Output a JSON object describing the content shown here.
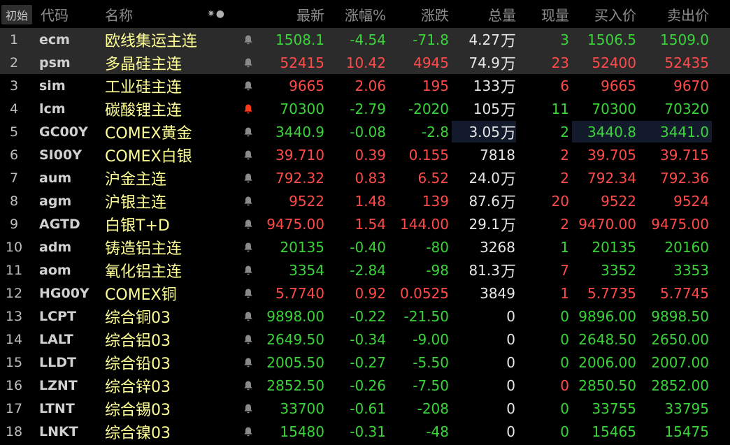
{
  "header": {
    "reset": "初始",
    "code": "代码",
    "name": "名称",
    "tools": "✷●",
    "latest": "最新",
    "pct": "涨幅%",
    "chg": "涨跌",
    "vol": "总量",
    "cur": "现量",
    "bid": "买入价",
    "ask": "卖出价"
  },
  "colors": {
    "up": "#ff4a4a",
    "down": "#3ad43a",
    "name": "#ffff96",
    "bell_active": "#ff3a1a",
    "bell_idle": "#8a8a8a"
  },
  "rows": [
    {
      "idx": "1",
      "code": "ecm",
      "name": "欧线集运主连",
      "bell": "idle",
      "latest": "1508.1",
      "pct": "-4.54",
      "chg": "-71.8",
      "vol": "4.27",
      "wan": "万",
      "cur": "3",
      "bid": "1506.5",
      "ask": "1509.0",
      "dir": "dn",
      "hl": true
    },
    {
      "idx": "2",
      "code": "psm",
      "name": "多晶硅主连",
      "bell": "idle",
      "latest": "52415",
      "pct": "10.42",
      "chg": "4945",
      "vol": "74.9",
      "wan": "万",
      "cur": "23",
      "bid": "52400",
      "ask": "52435",
      "dir": "up",
      "hl": true
    },
    {
      "idx": "3",
      "code": "sim",
      "name": "工业硅主连",
      "bell": "idle",
      "latest": "9665",
      "pct": "2.06",
      "chg": "195",
      "vol": "133",
      "wan": "万",
      "cur": "6",
      "bid": "9665",
      "ask": "9670",
      "dir": "up"
    },
    {
      "idx": "4",
      "code": "lcm",
      "name": "碳酸锂主连",
      "bell": "active",
      "latest": "70300",
      "pct": "-2.79",
      "chg": "-2020",
      "vol": "105",
      "wan": "万",
      "cur": "11",
      "bid": "70300",
      "ask": "70320",
      "dir": "dn"
    },
    {
      "idx": "5",
      "code": "GC00Y",
      "name": "COMEX黄金",
      "bell": "idle",
      "latest": "3440.9",
      "pct": "-0.08",
      "chg": "-2.8",
      "vol": "3.05",
      "wan": "万",
      "cur": "2",
      "bid": "3440.8",
      "ask": "3441.0",
      "dir": "dn",
      "box": true
    },
    {
      "idx": "6",
      "code": "SI00Y",
      "name": "COMEX白银",
      "bell": "idle",
      "latest": "39.710",
      "pct": "0.39",
      "chg": "0.155",
      "vol": "7818",
      "wan": "",
      "cur": "2",
      "bid": "39.705",
      "ask": "39.715",
      "dir": "up"
    },
    {
      "idx": "7",
      "code": "aum",
      "name": "沪金主连",
      "bell": "idle",
      "latest": "792.32",
      "pct": "0.83",
      "chg": "6.52",
      "vol": "24.0",
      "wan": "万",
      "cur": "2",
      "bid": "792.34",
      "ask": "792.36",
      "dir": "up"
    },
    {
      "idx": "8",
      "code": "agm",
      "name": "沪银主连",
      "bell": "idle",
      "latest": "9522",
      "pct": "1.48",
      "chg": "139",
      "vol": "87.6",
      "wan": "万",
      "cur": "20",
      "bid": "9522",
      "ask": "9524",
      "dir": "up"
    },
    {
      "idx": "9",
      "code": "AGTD",
      "name": "白银T+D",
      "bell": "idle",
      "latest": "9475.00",
      "pct": "1.54",
      "chg": "144.00",
      "vol": "29.1",
      "wan": "万",
      "cur": "2",
      "bid": "9470.00",
      "ask": "9475.00",
      "dir": "up"
    },
    {
      "idx": "10",
      "code": "adm",
      "name": "铸造铝主连",
      "bell": "idle",
      "latest": "20135",
      "pct": "-0.40",
      "chg": "-80",
      "vol": "3268",
      "wan": "",
      "cur": "1",
      "bid": "20135",
      "ask": "20160",
      "dir": "dn"
    },
    {
      "idx": "11",
      "code": "aom",
      "name": "氧化铝主连",
      "bell": "idle",
      "latest": "3354",
      "pct": "-2.84",
      "chg": "-98",
      "vol": "81.3",
      "wan": "万",
      "cur": "7",
      "bid": "3352",
      "ask": "3353",
      "dir": "dn",
      "curdir": "up"
    },
    {
      "idx": "12",
      "code": "HG00Y",
      "name": "COMEX铜",
      "bell": "idle",
      "latest": "5.7740",
      "pct": "0.92",
      "chg": "0.0525",
      "vol": "3849",
      "wan": "",
      "cur": "1",
      "bid": "5.7735",
      "ask": "5.7745",
      "dir": "up"
    },
    {
      "idx": "13",
      "code": "LCPT",
      "name": "综合铜03",
      "bell": "idle",
      "latest": "9898.00",
      "pct": "-0.22",
      "chg": "-21.50",
      "vol": "0",
      "wan": "",
      "cur": "0",
      "bid": "9896.00",
      "ask": "9898.50",
      "dir": "dn"
    },
    {
      "idx": "14",
      "code": "LALT",
      "name": "综合铝03",
      "bell": "idle",
      "latest": "2649.50",
      "pct": "-0.34",
      "chg": "-9.00",
      "vol": "0",
      "wan": "",
      "cur": "0",
      "bid": "2648.50",
      "ask": "2650.00",
      "dir": "dn"
    },
    {
      "idx": "15",
      "code": "LLDT",
      "name": "综合铅03",
      "bell": "idle",
      "latest": "2005.50",
      "pct": "-0.27",
      "chg": "-5.50",
      "vol": "0",
      "wan": "",
      "cur": "0",
      "bid": "2006.00",
      "ask": "2007.00",
      "dir": "dn"
    },
    {
      "idx": "16",
      "code": "LZNT",
      "name": "综合锌03",
      "bell": "idle",
      "latest": "2852.50",
      "pct": "-0.26",
      "chg": "-7.50",
      "vol": "0",
      "wan": "",
      "cur": "0",
      "bid": "2850.50",
      "ask": "2852.00",
      "dir": "dn",
      "curdir": "up"
    },
    {
      "idx": "17",
      "code": "LTNT",
      "name": "综合锡03",
      "bell": "idle",
      "latest": "33700",
      "pct": "-0.61",
      "chg": "-208",
      "vol": "0",
      "wan": "",
      "cur": "0",
      "bid": "33755",
      "ask": "33795",
      "dir": "dn"
    },
    {
      "idx": "18",
      "code": "LNKT",
      "name": "综合镍03",
      "bell": "idle",
      "latest": "15480",
      "pct": "-0.31",
      "chg": "-48",
      "vol": "0",
      "wan": "",
      "cur": "0",
      "bid": "15465",
      "ask": "15475",
      "dir": "dn"
    }
  ]
}
